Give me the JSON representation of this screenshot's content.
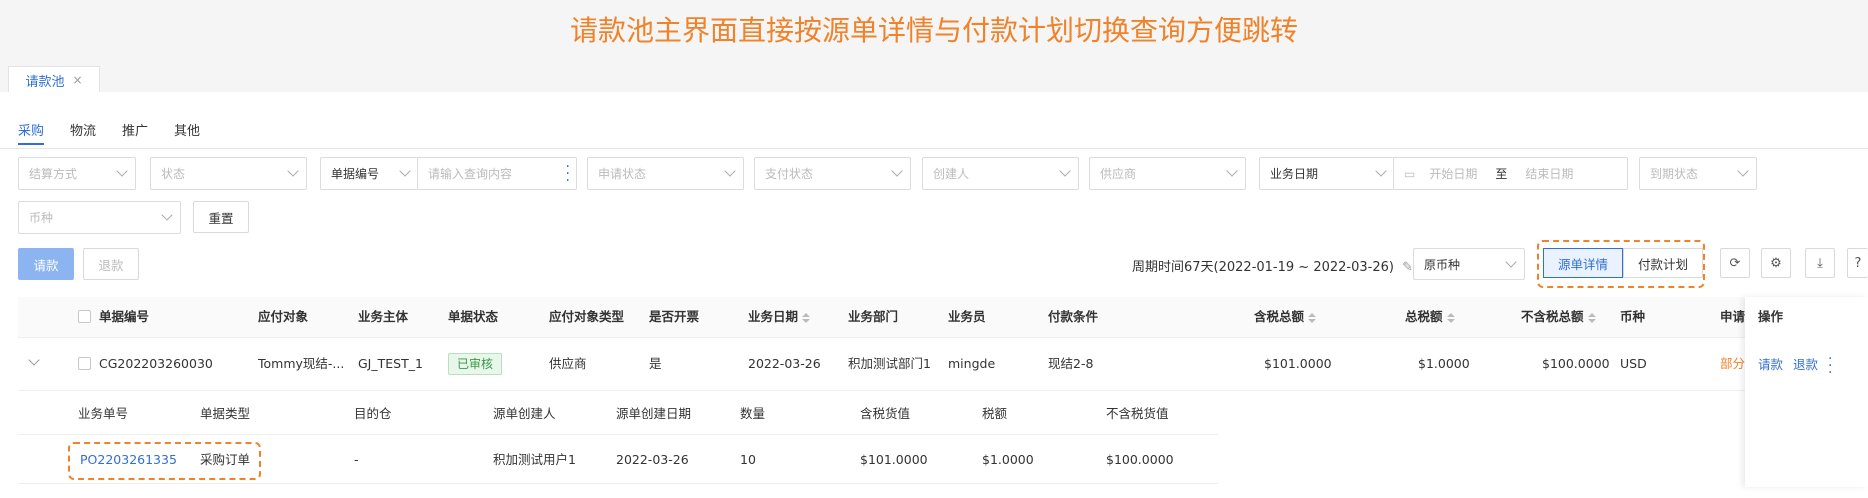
{
  "banner": "请款池主界面直接按源单详情与付款计划切换查询方便跳转",
  "tab": {
    "label": "请款池",
    "close": "×"
  },
  "subtabs": [
    "采购",
    "物流",
    "推广",
    "其他"
  ],
  "filters": {
    "settle": "结算方式",
    "status": "状态",
    "doc_type": "单据编号",
    "query_placeholder": "请输入查询内容",
    "apply_status": "申请状态",
    "pay_status": "支付状态",
    "creator": "创建人",
    "supplier": "供应商",
    "biz_date": "业务日期",
    "start_date": "开始日期",
    "to": "至",
    "end_date": "结束日期",
    "due_status": "到期状态",
    "currency": "币种",
    "reset": "重置"
  },
  "toolbar": {
    "request": "请款",
    "refund": "退款",
    "period": "周期时间67天(2022-01-19 ~ 2022-03-26)",
    "currency_select": "原币种",
    "seg_source": "源单详情",
    "seg_plan": "付款计划"
  },
  "columns": [
    "单据编号",
    "应付对象",
    "业务主体",
    "单据状态",
    "应付对象类型",
    "是否开票",
    "业务日期",
    "业务部门",
    "业务员",
    "付款条件",
    "含税总额",
    "总税额",
    "不含税总额",
    "币种",
    "申请"
  ],
  "ops_header": "操作",
  "row": {
    "doc_no": "CG202203260030",
    "payee": "Tommy现结-...",
    "entity": "GJ_TEST_1",
    "status": "已审核",
    "payee_type": "供应商",
    "invoiced": "是",
    "biz_date": "2022-03-26",
    "dept": "积加测试部门1",
    "salesman": "mingde",
    "terms": "现结2-8",
    "total_tax_incl": "$101.0000",
    "total_tax": "$1.0000",
    "total_excl": "$100.0000",
    "currency": "USD",
    "apply": "部分",
    "op_request": "请款",
    "op_refund": "退款"
  },
  "sub_columns": [
    "业务单号",
    "单据类型",
    "目的仓",
    "源单创建人",
    "源单创建日期",
    "数量",
    "含税货值",
    "税额",
    "不含税货值"
  ],
  "sub_row": {
    "biz_no": "PO2203261335",
    "doc_type": "采购订单",
    "warehouse": "-",
    "creator": "积加测试用户1",
    "created": "2022-03-26",
    "qty": "10",
    "value_incl": "$101.0000",
    "tax": "$1.0000",
    "value_excl": "$100.0000"
  }
}
